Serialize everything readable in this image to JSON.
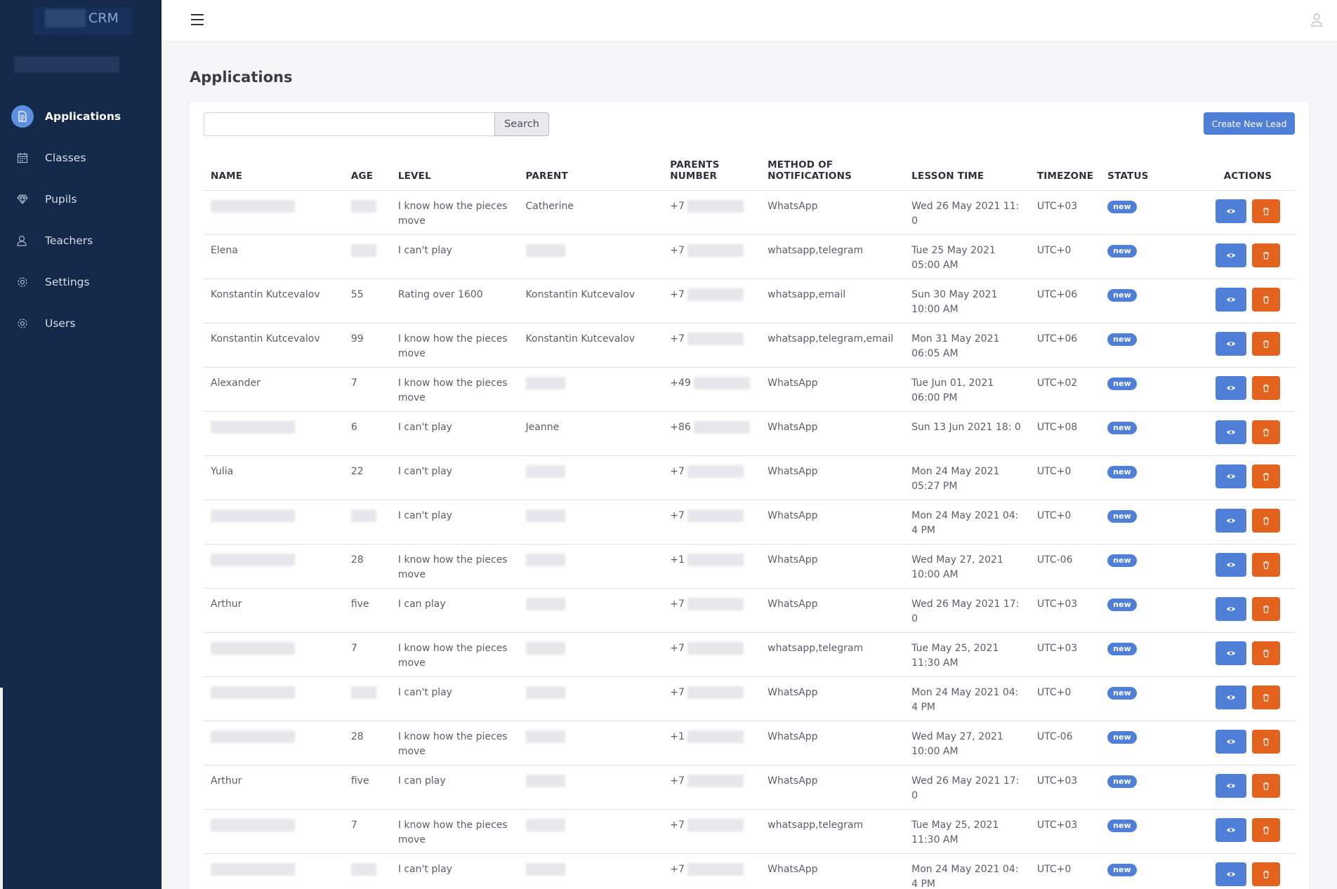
{
  "brand": {
    "name": "CRM"
  },
  "sidebar": {
    "items": [
      {
        "label": "Applications",
        "icon": "document-icon",
        "active": true
      },
      {
        "label": "Classes",
        "icon": "calendar-icon",
        "active": false
      },
      {
        "label": "Pupils",
        "icon": "diamond-icon",
        "active": false
      },
      {
        "label": "Teachers",
        "icon": "teacher-icon",
        "active": false
      },
      {
        "label": "Settings",
        "icon": "gear-icon",
        "active": false
      },
      {
        "label": "Users",
        "icon": "gear-icon",
        "active": false
      }
    ]
  },
  "page": {
    "title": "Applications"
  },
  "search": {
    "value": "",
    "button_label": "Search"
  },
  "create_button": {
    "label": "Create New Lead"
  },
  "table": {
    "headers": {
      "name": "NAME",
      "age": "AGE",
      "level": "LEVEL",
      "parent": "PARENT",
      "parents_number": "PARENTS NUMBER",
      "method": "METHOD OF NOTIFICATIONS",
      "lesson_time": "LESSON TIME",
      "timezone": "TIMEZONE",
      "status": "STATUS",
      "actions": "ACTIONS"
    },
    "rows": [
      {
        "name": "",
        "age": "",
        "level": "I know how the pieces move",
        "parent": "Catherine",
        "phone": "+7",
        "method": "WhatsApp",
        "lesson": "Wed 26 May 2021 11: 0",
        "tz": "UTC+03",
        "status": "new"
      },
      {
        "name": "Elena",
        "age": "",
        "level": "I can't play",
        "parent": "",
        "phone": "+7",
        "method": "whatsapp,telegram",
        "lesson": "Tue 25 May 2021 05:00 AM",
        "tz": "UTC+0",
        "status": "new"
      },
      {
        "name": "Konstantin Kutcevalov",
        "age": "55",
        "level": "Rating over 1600",
        "parent": "Konstantin Kutcevalov",
        "phone": "+7",
        "method": "whatsapp,email",
        "lesson": "Sun 30 May 2021 10:00 AM",
        "tz": "UTC+06",
        "status": "new"
      },
      {
        "name": "Konstantin Kutcevalov",
        "age": "99",
        "level": "I know how the pieces move",
        "parent": "Konstantin Kutcevalov",
        "phone": "+7",
        "method": "whatsapp,telegram,email",
        "lesson": "Mon 31 May 2021 06:05 AM",
        "tz": "UTC+06",
        "status": "new"
      },
      {
        "name": "Alexander",
        "age": "7",
        "level": "I know how the pieces move",
        "parent": "",
        "phone": "+49",
        "method": "WhatsApp",
        "lesson": "Tue Jun 01, 2021 06:00 PM",
        "tz": "UTC+02",
        "status": "new"
      },
      {
        "name": "",
        "age": "6",
        "level": "I can't play",
        "parent": "Jeanne",
        "phone": "+86",
        "method": "WhatsApp",
        "lesson": "Sun 13 Jun 2021 18: 0",
        "tz": "UTC+08",
        "status": "new"
      },
      {
        "name": "Yulia",
        "age": "22",
        "level": "I can't play",
        "parent": "",
        "phone": "+7",
        "method": "WhatsApp",
        "lesson": "Mon 24 May 2021 05:27 PM",
        "tz": "UTC+0",
        "status": "new"
      },
      {
        "name": "",
        "age": "",
        "level": "I can't play",
        "parent": "",
        "phone": "+7",
        "method": "WhatsApp",
        "lesson": "Mon 24 May 2021 04: 4 PM",
        "tz": "UTC+0",
        "status": "new"
      },
      {
        "name": "",
        "age": "28",
        "level": "I know how the pieces move",
        "parent": "",
        "phone": "+1",
        "method": "WhatsApp",
        "lesson": "Wed May 27, 2021 10:00 AM",
        "tz": "UTC-06",
        "status": "new"
      },
      {
        "name": "Arthur",
        "age": "five",
        "level": "I can play",
        "parent": "",
        "phone": "+7",
        "method": "WhatsApp",
        "lesson": "Wed 26 May 2021 17: 0",
        "tz": "UTC+03",
        "status": "new"
      },
      {
        "name": "",
        "age": "7",
        "level": "I know how the pieces move",
        "parent": "",
        "phone": "+7",
        "method": "whatsapp,telegram",
        "lesson": "Tue May 25, 2021 11:30 AM",
        "tz": "UTC+03",
        "status": "new"
      },
      {
        "name": "",
        "age": "",
        "level": "I can't play",
        "parent": "",
        "phone": "+7",
        "method": "WhatsApp",
        "lesson": "Mon 24 May 2021 04: 4 PM",
        "tz": "UTC+0",
        "status": "new"
      },
      {
        "name": "",
        "age": "28",
        "level": "I know how the pieces move",
        "parent": "",
        "phone": "+1",
        "method": "WhatsApp",
        "lesson": "Wed May 27, 2021 10:00 AM",
        "tz": "UTC-06",
        "status": "new"
      },
      {
        "name": "Arthur",
        "age": "five",
        "level": "I can play",
        "parent": "",
        "phone": "+7",
        "method": "WhatsApp",
        "lesson": "Wed 26 May 2021 17: 0",
        "tz": "UTC+03",
        "status": "new"
      },
      {
        "name": "",
        "age": "7",
        "level": "I know how the pieces move",
        "parent": "",
        "phone": "+7",
        "method": "whatsapp,telegram",
        "lesson": "Tue May 25, 2021 11:30 AM",
        "tz": "UTC+03",
        "status": "new"
      },
      {
        "name": "",
        "age": "",
        "level": "I can't play",
        "parent": "",
        "phone": "+7",
        "method": "WhatsApp",
        "lesson": "Mon 24 May 2021 04: 4 PM",
        "tz": "UTC+0",
        "status": "new"
      }
    ]
  },
  "colors": {
    "sidebar_bg": "#142849",
    "primary": "#4f7fd6",
    "danger": "#e2621e"
  }
}
